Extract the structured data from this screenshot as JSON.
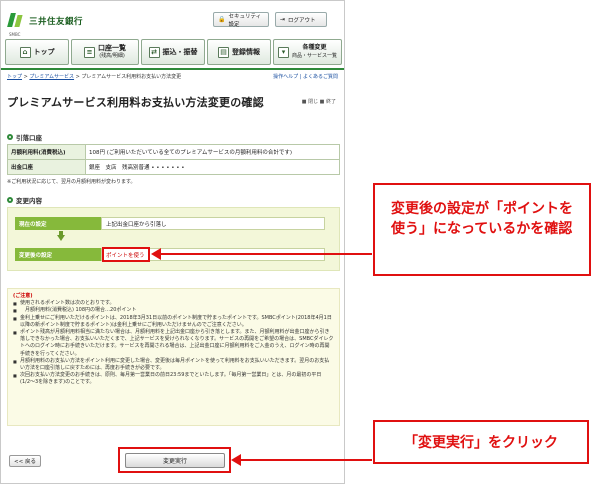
{
  "header": {
    "bank_name": "三井住友銀行",
    "bank_sub": "SMBC",
    "security_btn": "セキュリティ設定",
    "logout_btn": "ログアウト"
  },
  "nav": [
    {
      "icon": "home-icon",
      "label": "トップ",
      "sub": ""
    },
    {
      "icon": "list-icon",
      "label": "口座一覧",
      "sub": "(残高/明細)"
    },
    {
      "icon": "transfer-icon",
      "label": "振込・振替",
      "sub": ""
    },
    {
      "icon": "register-icon",
      "label": "登録情報",
      "sub": ""
    },
    {
      "icon": "settings-icon",
      "label": "各種変更",
      "sub": "商品・サービス一覧"
    }
  ],
  "breadcrumb": {
    "items": [
      "トップ",
      "プレミアムサービス",
      "プレミアムサービス利用料お支払い方法変更"
    ],
    "right": "操作ヘルプ | よくあるご質問"
  },
  "page": {
    "title": "プレミアムサービス利用料お支払い方法変更の確認",
    "tools": "■ 閉じ ■ 終了"
  },
  "debit_section": {
    "heading": "引落口座",
    "rows": [
      {
        "label": "月額利用料(消費税込)",
        "value": "108円 (ご利用いただいている全てのプレミアムサービスの月額利用料の合計です)"
      },
      {
        "label": "出金口座",
        "value": "銀座　支店　残高別普通 • • • • • • •"
      }
    ],
    "note": "※ご利用状況に応じて、翌月の月額利用料が変わります。"
  },
  "change_section": {
    "heading": "変更内容",
    "current_label": "現在の設定",
    "current_value": "上記出金口座から引落し",
    "new_label": "変更後の設定",
    "new_value": "ポイントを使う"
  },
  "notice": {
    "title": "(ご注意)",
    "items": [
      "使用されるポイント数は次のとおりです。",
      "　月額利用料(消費税込) 108円の場合…20ポイント",
      "金利上乗せにご利用いただけるポイントは、2018年3月31日以前のポイント制度で貯まったポイントです。SMBCポイント(2018年4月1日以降の新ポイント制度で貯まるポイント)は金利上乗せにご利用いただけませんのでご注意ください。",
      "ポイント残高が月額利用料相当に満たない場合は、月額利用料を上記出金口座から引き落とします。また、月額利用料が出金口座から引き落しできなかった場合、お支払いいただくまで、上記サービスを受けられなくなります。サービスの再開をご希望の場合は、SMBCダイレクトへのログイン時にお手続きいただけます。サービスを再開される場合は、上記出金口座に月額利用料をご入金のうえ、ログイン時の再開手続きを行ってください。",
      "月額利用料のお支払い方法をポイント利用に変更した場合、変更後は毎月ポイントを使って利用料をお支払いいただきます。翌月のお支払い方法を口座引落しに戻すためには、再度お手続きが必要です。",
      "次回お支払い方法変更のお手続きは、原則、毎月第一営業日の前日23:59までといたします。「毎月第一営業日」とは、月の最初の平日(1/2〜3を除きます)のことです。"
    ]
  },
  "footer": {
    "back_btn": "<< 戻る",
    "exec_btn": "変更実行"
  },
  "callouts": {
    "first": "変更後の設定が「ポイントを使う」になっているかを確認",
    "second": "「変更実行」をクリック"
  },
  "colors": {
    "brand_green": "#2f8a3a",
    "label_green": "#86b93b",
    "highlight_red": "#e01010"
  }
}
